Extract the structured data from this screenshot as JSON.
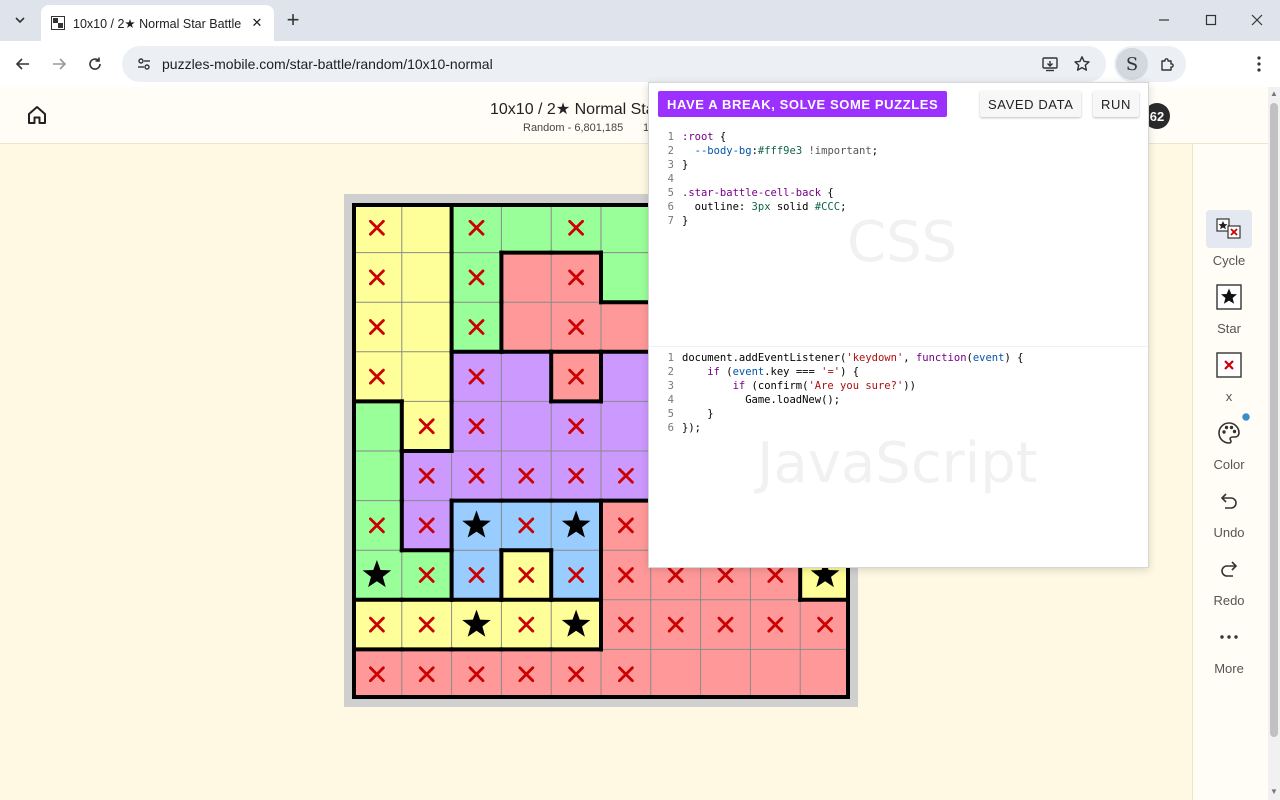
{
  "browser": {
    "tab_title": "10x10 / 2★ Normal Star Battle",
    "url": "puzzles-mobile.com/star-battle/random/10x10-normal"
  },
  "page": {
    "title": "10x10 / 2★ Normal Sta",
    "subtitle": "Random - 6,801,185",
    "subtitle_fragment": "1",
    "badge": "62"
  },
  "tools": [
    {
      "label": "Cycle",
      "icon": "cycle-icon"
    },
    {
      "label": "Star",
      "icon": "star-icon"
    },
    {
      "label": "x",
      "icon": "x-mark-icon"
    },
    {
      "label": "Color",
      "icon": "palette-icon"
    },
    {
      "label": "Undo",
      "icon": "undo-icon"
    },
    {
      "label": "Redo",
      "icon": "redo-icon"
    },
    {
      "label": "More",
      "icon": "more-dots-icon"
    }
  ],
  "popup": {
    "cta": "HAVE A BREAK, SOLVE SOME PUZZLES",
    "saved": "SAVED DATA",
    "run": "RUN",
    "css_watermark": "CSS",
    "js_watermark": "JavaScript",
    "css_lines": [
      ":root {",
      "  --body-bg:#fff9e3 !important;",
      "}",
      "",
      ".star-battle-cell-back {",
      "  outline: 3px solid #CCC;",
      "}"
    ],
    "js_lines": [
      "document.addEventListener('keydown', function(event) {",
      "    if (event.key === '=') {",
      "        if (confirm('Are you sure?'))",
      "          Game.loadNew();",
      "    }",
      "});"
    ]
  },
  "colors": {
    "Y": "#ffff99",
    "G": "#99ff99",
    "R": "#ff9999",
    "P": "#cc99ff",
    "B": "#99ccff",
    "mark_x": "#cc0000",
    "star": "#000000",
    "page_bg": "#fff9e3",
    "cta_bg": "#9b30ff"
  },
  "board": {
    "size": 10,
    "regions": [
      [
        "Y1",
        "Y1",
        "G1",
        "G1",
        "G1",
        "G1",
        "G1",
        "G1",
        "G1",
        "G1"
      ],
      [
        "Y1",
        "Y1",
        "G1",
        "R1",
        "R1",
        "G1",
        "G1",
        "G1",
        "G1",
        "G1"
      ],
      [
        "Y1",
        "Y1",
        "G1",
        "R1",
        "R1",
        "R1",
        "R1",
        "R1",
        "R1",
        "R1"
      ],
      [
        "Y1",
        "Y1",
        "P",
        "P",
        "R2",
        "P",
        "P",
        "P",
        "P",
        "P"
      ],
      [
        "G2",
        "Y1",
        "P",
        "P",
        "P",
        "P",
        "P",
        "P",
        "P",
        "P"
      ],
      [
        "G2",
        "P",
        "P",
        "P",
        "P",
        "P",
        "P",
        "P",
        "P",
        "P"
      ],
      [
        "G2",
        "P",
        "B",
        "B",
        "B",
        "R3",
        "R3",
        "R3",
        "R3",
        "R3"
      ],
      [
        "G2",
        "G2",
        "B",
        "Y2",
        "B",
        "R3",
        "R3",
        "R3",
        "R3",
        "Y3"
      ],
      [
        "Y4",
        "Y4",
        "Y4",
        "Y4",
        "Y4",
        "R3",
        "R3",
        "R3",
        "R3",
        "R3"
      ],
      [
        "R3",
        "R3",
        "R3",
        "R3",
        "R3",
        "R3",
        "R3",
        "R3",
        "R3",
        "R3"
      ]
    ],
    "region_colors": {
      "Y1": "Y",
      "Y2": "Y",
      "Y3": "Y",
      "Y4": "Y",
      "G1": "G",
      "G2": "G",
      "R1": "R",
      "R2": "R",
      "R3": "R",
      "P": "P",
      "B": "B"
    },
    "marks": [
      "X.X.X.....",
      "X.X.X.....",
      "X.X.X.....",
      "X.X.X.....",
      ".XX.X.....",
      ".XXXXX....",
      "XX*X*X....",
      "*XXXXXXXX*",
      "XX*X*XXXXX",
      "XXXXXX...."
    ]
  }
}
